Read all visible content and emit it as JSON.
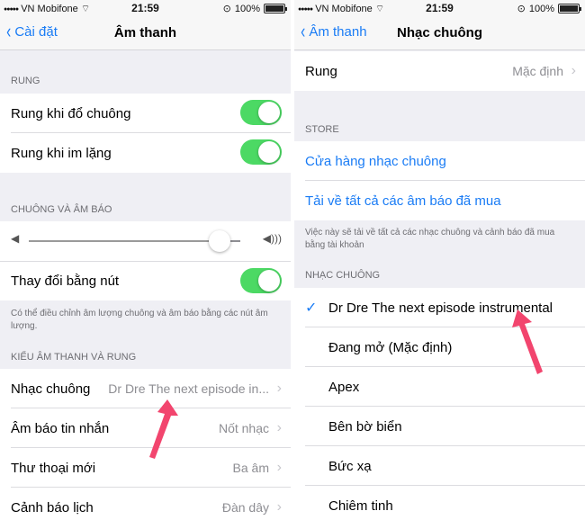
{
  "status_bar": {
    "carrier": "VN Mobifone",
    "time": "21:59",
    "battery": "100%"
  },
  "left": {
    "nav": {
      "back": "Cài đặt",
      "title": "Âm thanh"
    },
    "rung_section": "RUNG",
    "rung_rows": [
      {
        "label": "Rung khi đổ chuông",
        "on": true
      },
      {
        "label": "Rung khi im lặng",
        "on": true
      }
    ],
    "chuong_section": "CHUÔNG VÀ ÂM BÁO",
    "volume_level": 0.9,
    "thay_doi": {
      "label": "Thay đổi bằng nút",
      "on": true
    },
    "footer_note": "Có thể điều chỉnh âm lượng chuông và âm báo bằng các nút âm lượng.",
    "kieu_section": "KIỂU ÂM THANH VÀ RUNG",
    "sound_rows": [
      {
        "label": "Nhạc chuông",
        "value": "Dr Dre The next episode in..."
      },
      {
        "label": "Âm báo tin nhắn",
        "value": "Nốt nhạc"
      },
      {
        "label": "Thư thoại mới",
        "value": "Ba âm"
      },
      {
        "label": "Cảnh báo lịch",
        "value": "Đàn dây"
      }
    ]
  },
  "right": {
    "nav": {
      "back": "Âm thanh",
      "title": "Nhạc chuông"
    },
    "rung_row": {
      "label": "Rung",
      "value": "Mặc định"
    },
    "store_section": "STORE",
    "store_links": [
      "Cửa hàng nhạc chuông",
      "Tải về tất cả các âm báo đã mua"
    ],
    "store_note": "Việc này sẽ tải về tất cả các nhạc chuông và cảnh báo đã mua bằng tài khoản",
    "ringtones_section": "NHẠC CHUÔNG",
    "ringtones": [
      {
        "label": "Dr Dre The next episode instrumental",
        "selected": true
      },
      {
        "label": "Đang mở (Mặc định)",
        "selected": false
      },
      {
        "label": "Apex",
        "selected": false
      },
      {
        "label": "Bên bờ biển",
        "selected": false
      },
      {
        "label": "Bức xạ",
        "selected": false
      },
      {
        "label": "Chiêm tinh",
        "selected": false
      }
    ]
  },
  "colors": {
    "accent": "#1a7cf5",
    "toggle_on": "#4cd964",
    "arrow": "#f2456e"
  },
  "icons": [
    "chevron-left-icon",
    "chevron-right-icon",
    "checkmark-icon",
    "speaker-low-icon",
    "speaker-high-icon",
    "battery-icon",
    "signal-icon",
    "wifi-icon",
    "lock-rotation-icon",
    "pointer-arrow-icon"
  ]
}
